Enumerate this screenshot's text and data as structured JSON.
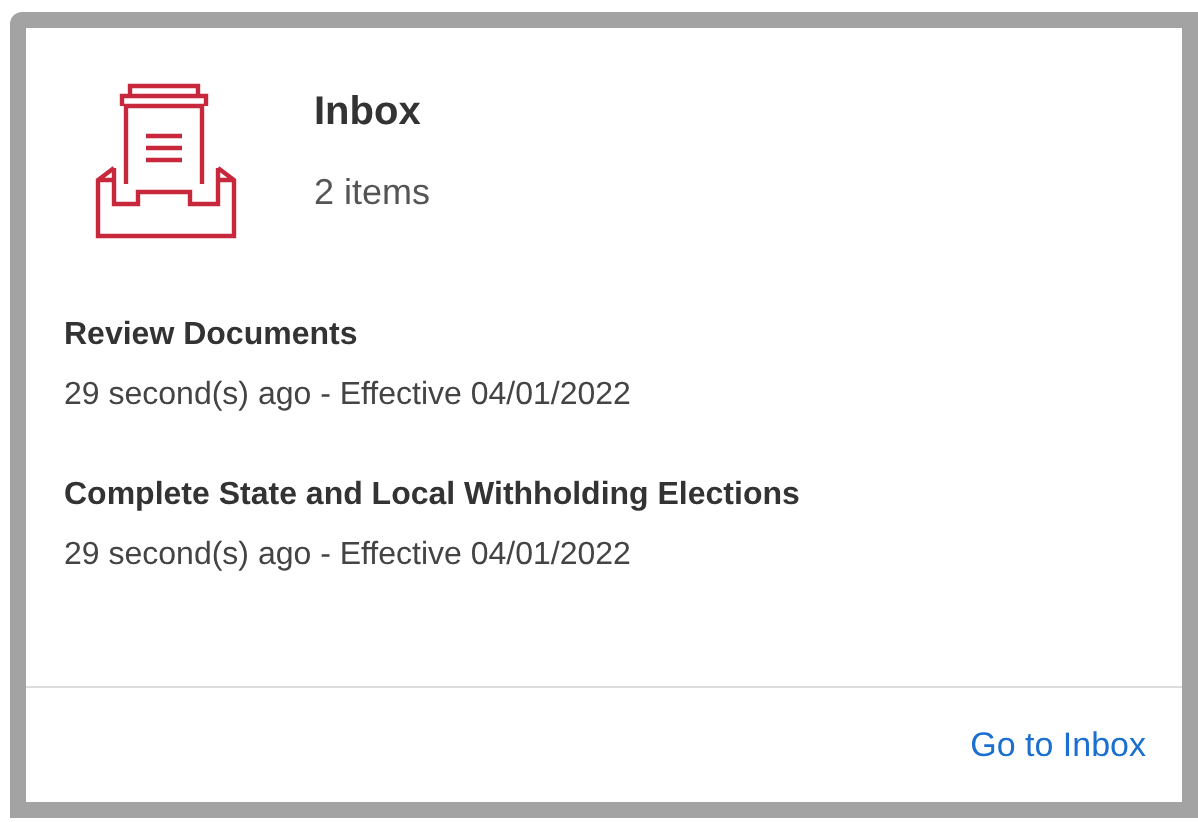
{
  "header": {
    "title": "Inbox",
    "count": "2 items"
  },
  "items": [
    {
      "title": "Review Documents",
      "meta": "29 second(s) ago - Effective 04/01/2022"
    },
    {
      "title": "Complete State and Local Withholding Elections",
      "meta": "29 second(s) ago - Effective 04/01/2022"
    }
  ],
  "footer": {
    "link": "Go to Inbox"
  }
}
